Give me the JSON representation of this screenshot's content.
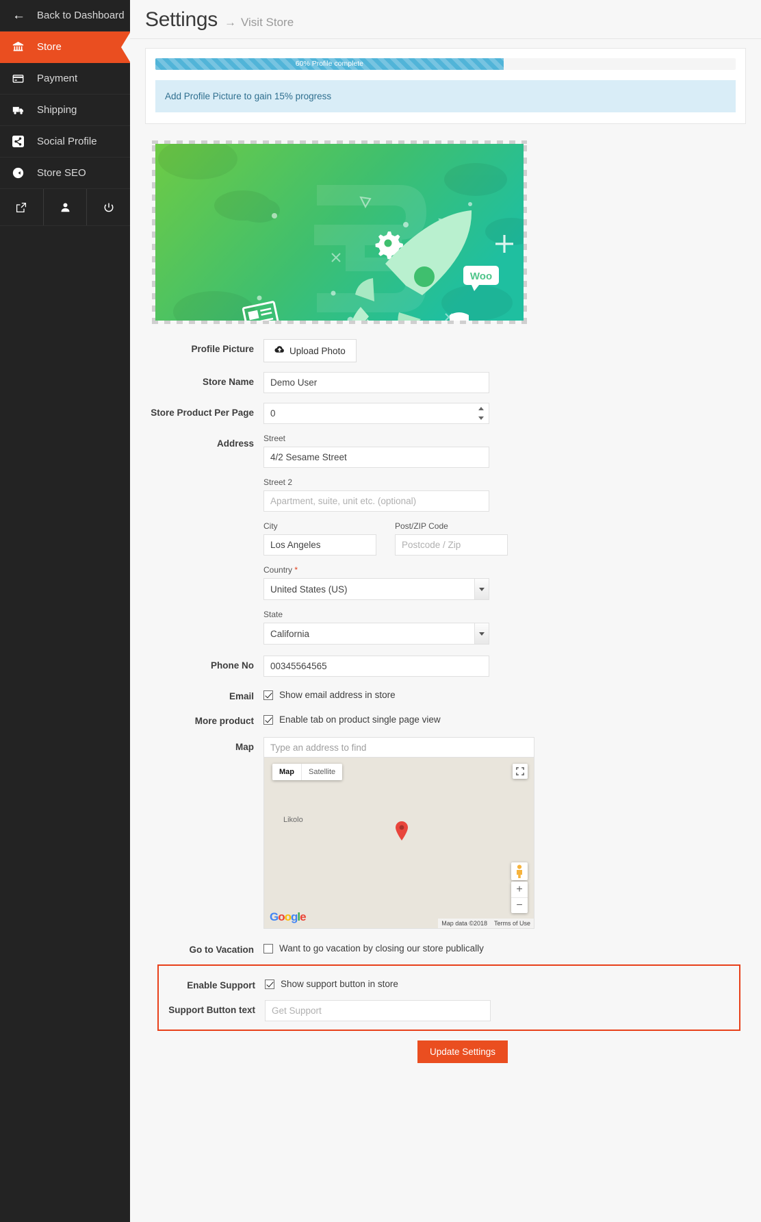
{
  "sidebar": {
    "back": {
      "label": "Back to Dashboard",
      "icon": "arrow-left-icon"
    },
    "items": [
      {
        "label": "Store",
        "icon": "bank-icon",
        "active": true
      },
      {
        "label": "Payment",
        "icon": "card-icon",
        "active": false
      },
      {
        "label": "Shipping",
        "icon": "truck-icon",
        "active": false
      },
      {
        "label": "Social Profile",
        "icon": "share-icon",
        "active": false
      },
      {
        "label": "Store SEO",
        "icon": "globe-icon",
        "active": false
      }
    ],
    "bottom_icons": [
      "external-link-icon",
      "user-icon",
      "power-icon"
    ]
  },
  "header": {
    "title": "Settings",
    "separator": "→",
    "visit_store": "Visit Store"
  },
  "progress": {
    "percent": 60,
    "bar_label": "60% Profile complete",
    "note": "Add Profile Picture to gain 15% progress",
    "fill_color": "#51b4d8",
    "note_bg": "#d9edf7"
  },
  "banner": {
    "alt": "store banner rocket illustration",
    "woo_label": "Woo"
  },
  "form": {
    "profile_picture": {
      "label": "Profile Picture",
      "button": "Upload Photo",
      "icon": "cloud-upload-icon"
    },
    "store_name": {
      "label": "Store Name",
      "value": "Demo User",
      "placeholder": ""
    },
    "products_per_page": {
      "label": "Store Product Per Page",
      "value": "0"
    },
    "address": {
      "label": "Address",
      "street": {
        "label": "Street",
        "value": "4/2 Sesame Street",
        "placeholder": ""
      },
      "street2": {
        "label": "Street 2",
        "value": "",
        "placeholder": "Apartment, suite, unit etc. (optional)"
      },
      "city": {
        "label": "City",
        "value": "Los Angeles",
        "placeholder": ""
      },
      "postcode": {
        "label": "Post/ZIP Code",
        "value": "",
        "placeholder": "Postcode / Zip"
      },
      "country": {
        "label": "Country",
        "required_mark": "*",
        "value": "United States (US)"
      },
      "state": {
        "label": "State",
        "value": "California"
      }
    },
    "phone": {
      "label": "Phone No",
      "value": "00345564565"
    },
    "email": {
      "label": "Email",
      "checkbox_label": "Show email address in store",
      "checked": true
    },
    "more_product": {
      "label": "More product",
      "checkbox_label": "Enable tab on product single page view",
      "checked": true
    },
    "map": {
      "label": "Map",
      "search_placeholder": "Type an address to find",
      "types": [
        {
          "label": "Map",
          "selected": true
        },
        {
          "label": "Satellite",
          "selected": false
        }
      ],
      "place_label": "Likolo",
      "logo": "Google",
      "attribution": "Map data ©2018",
      "terms": "Terms of Use",
      "zoom_in": "+",
      "zoom_out": "−"
    },
    "vacation": {
      "label": "Go to Vacation",
      "checkbox_label": "Want to go vacation by closing our store publically",
      "checked": false
    },
    "enable_support": {
      "label": "Enable Support",
      "checkbox_label": "Show support button in store",
      "checked": true
    },
    "support_button_text": {
      "label": "Support Button text",
      "value": "",
      "placeholder": "Get Support"
    },
    "submit": {
      "label": "Update Settings",
      "color": "#ea4e20"
    }
  },
  "colors": {
    "accent": "#ea4e20",
    "sidebar_bg": "#232323",
    "highlight_border": "#e8401a"
  }
}
